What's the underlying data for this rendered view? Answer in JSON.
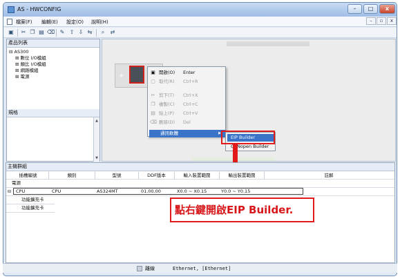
{
  "window": {
    "title": "AS - HWCONFIG",
    "minimize": "–",
    "maximize": "□",
    "close": "x"
  },
  "menubar": {
    "file": "檔案(F)",
    "edit": "編輯(E)",
    "settings": "設定(O)",
    "help": "說明(H)",
    "mdi_min": "–",
    "mdi_restore": "▫",
    "mdi_close": "x"
  },
  "left": {
    "product_list_title": "產品列表",
    "tree": {
      "root": "AS300",
      "digital": "數位 I/O模組",
      "analog": "類比 I/O模組",
      "network": "網路模組",
      "power": "電源"
    },
    "spec_title": "規格"
  },
  "context_menu": {
    "items": [
      {
        "label": "開啟(O)",
        "shortcut": "Enter",
        "disabled": false
      },
      {
        "label": "取代(R)",
        "shortcut": "Ctrl+R",
        "disabled": true
      },
      {
        "label": "剪下(T)",
        "shortcut": "Ctrl+X",
        "disabled": true
      },
      {
        "label": "複製(C)",
        "shortcut": "Ctrl+C",
        "disabled": true
      },
      {
        "label": "貼上(P)",
        "shortcut": "Ctrl+V",
        "disabled": true
      },
      {
        "label": "刪除(D)",
        "shortcut": "Del",
        "disabled": true
      }
    ],
    "comm_label": "通訊軟體",
    "comm_arrow": "▶"
  },
  "submenu": {
    "eip_builder": "EIP Builder",
    "canopen_builder": "CANopen Builder"
  },
  "bottom": {
    "title": "主機群組",
    "headers": [
      "插槽編號",
      "類別",
      "型號",
      "DDF版本",
      "輸入裝置範圍",
      "輸出裝置範圍",
      "註解"
    ],
    "group_label": "電源",
    "cpu_row": {
      "slot": "CPU",
      "category": "CPU",
      "model": "AS324MT",
      "ddf": "01.00.00",
      "input_range": "X0.0 ~ X0.15",
      "output_range": "Y0.0 ~ Y0.15"
    },
    "sub_rows": [
      "功能擴充卡",
      "功能擴充卡"
    ]
  },
  "callout": {
    "text": "點右鍵開啟EIP Builder."
  },
  "status": {
    "mode": "離線",
    "connection": "Ethernet, [Ethernet]"
  },
  "colors": {
    "highlight": "#e11b1b",
    "selection": "#3a74c8",
    "titlebar": "#9fbde6"
  }
}
